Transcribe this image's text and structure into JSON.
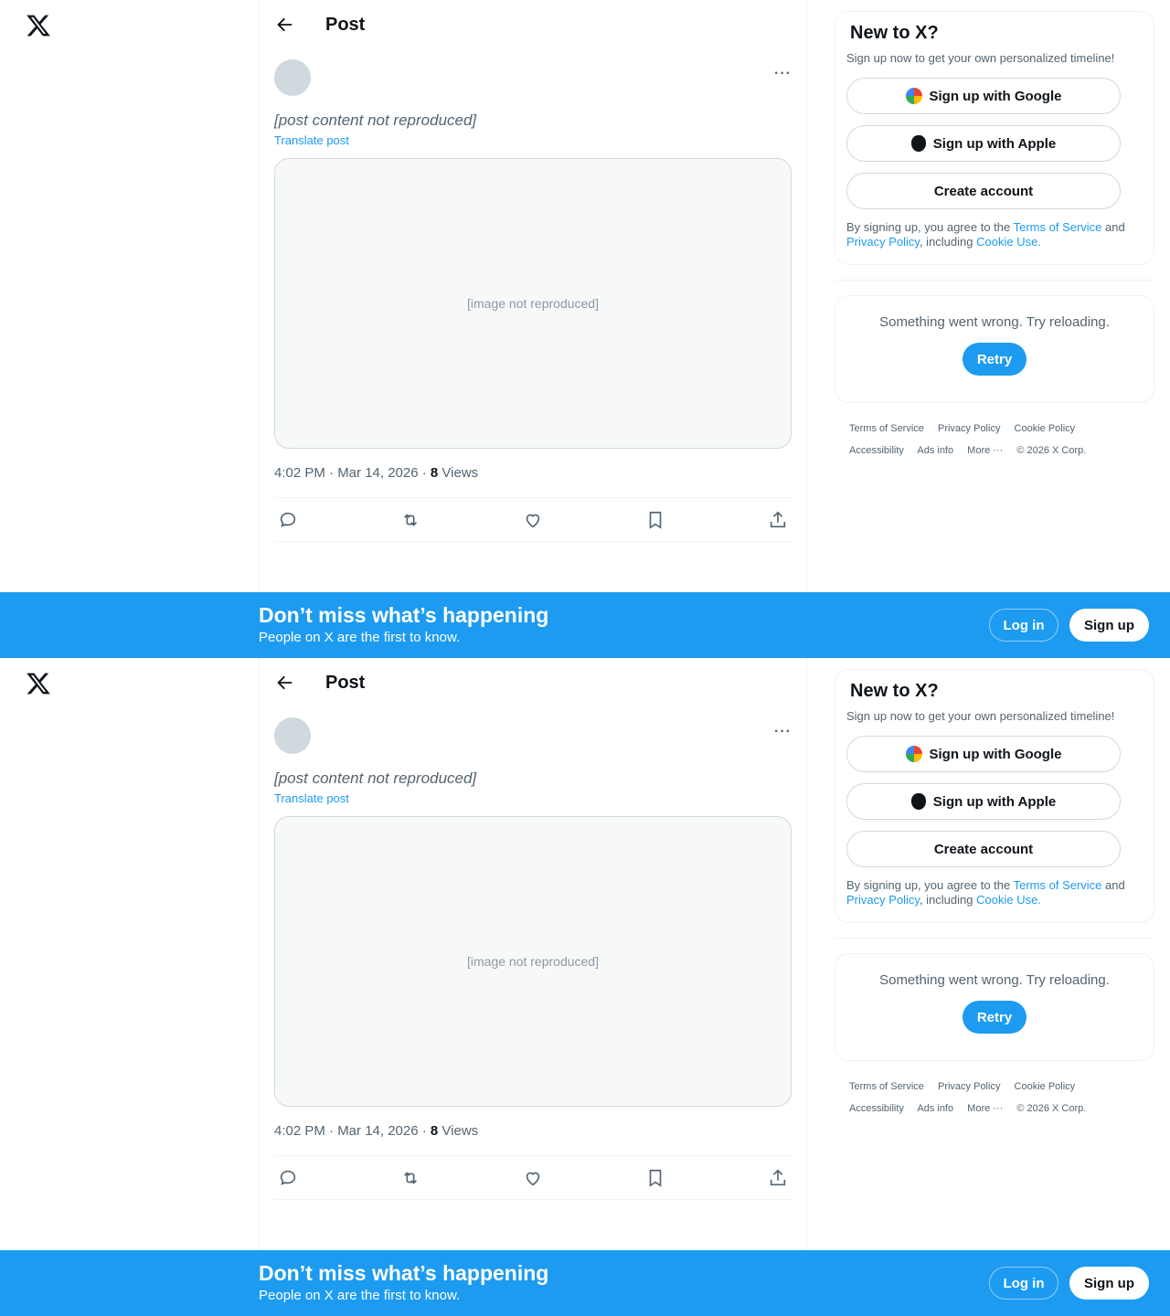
{
  "header": {
    "title": "Post"
  },
  "post": {
    "text": "[post content not reproduced]",
    "translate_label": "Translate post",
    "media_placeholder": "[image not reproduced]",
    "timestamp": "4:02 PM · Mar 14, 2026 · ",
    "views_count": "8",
    "views_label": " Views"
  },
  "sidebar": {
    "title": "New to X?",
    "subtitle": "Sign up now to get your own personalized timeline!",
    "google_label": "Sign up with Google",
    "apple_label": "Sign up with Apple",
    "create_label": "Create account",
    "legal_1": "By signing up, you agree to the ",
    "tos": "Terms of Service",
    "legal_2": " and ",
    "privacy": "Privacy Policy",
    "legal_3": ", including ",
    "cookie": "Cookie Use.",
    "error_text": "Something went wrong. Try reloading.",
    "retry_label": "Retry"
  },
  "footer": {
    "links": [
      "Terms of Service",
      "Privacy Policy",
      "Cookie Policy",
      "Accessibility",
      "Ads info",
      "More ···",
      "© 2026 X Corp."
    ]
  },
  "banner": {
    "title": "Don’t miss what’s happening",
    "subtitle": "People on X are the first to know.",
    "login_label": "Log in",
    "signup_label": "Sign up"
  },
  "colors": {
    "accent": "#1d9bf0",
    "text": "#0f1419",
    "muted": "#536471"
  }
}
